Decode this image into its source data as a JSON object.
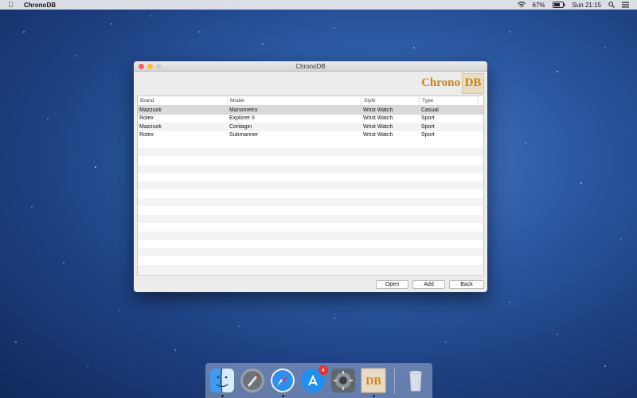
{
  "menubar": {
    "app_name": "ChronoDB",
    "battery": "67%",
    "clock": "Sun 21:15"
  },
  "window": {
    "title": "ChronoDB",
    "logo": {
      "text_chrono": "Chrono",
      "text_db": "DB"
    },
    "table": {
      "headers": [
        "Brand",
        "Model",
        "Style",
        "Type"
      ],
      "rows": [
        [
          "Mazzuoli",
          "Manometro",
          "Wrist Watch",
          "Casual"
        ],
        [
          "Rolex",
          "Explorer II",
          "Wrist Watch",
          "Sport"
        ],
        [
          "Mazzuoli",
          "Contagiri",
          "Wrist Watch",
          "Sport"
        ],
        [
          "Rolex",
          "Submariner",
          "Wrist Watch",
          "Sport"
        ]
      ],
      "selected_row": 0
    },
    "buttons": {
      "open": "Open",
      "add": "Add",
      "back": "Back"
    }
  },
  "dock": {
    "items": [
      "finder-icon",
      "launchpad-icon",
      "safari-icon",
      "app-store-icon",
      "system-preferences-icon",
      "chronodb-icon",
      "trash-icon"
    ],
    "app_store_badge": "4"
  }
}
